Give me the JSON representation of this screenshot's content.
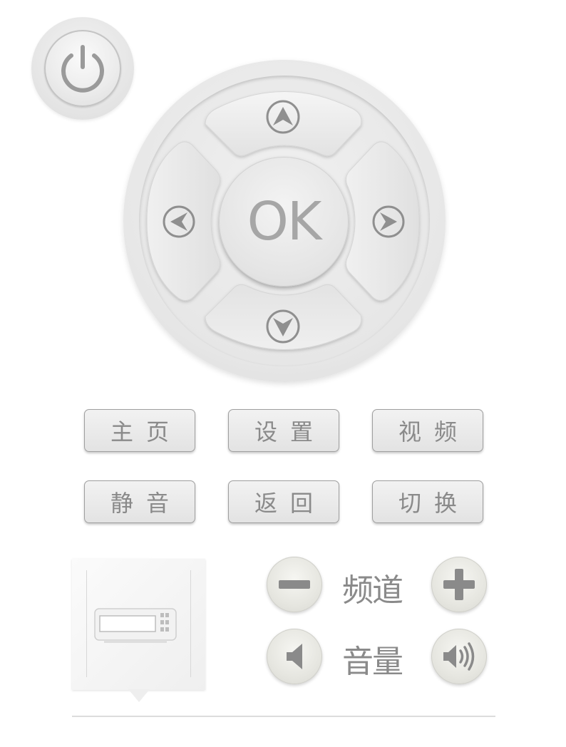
{
  "power": {
    "icon": "power-icon"
  },
  "dpad": {
    "ok_label": "OK",
    "icons": {
      "up": "arrow-up-icon",
      "down": "arrow-down-icon",
      "left": "arrow-left-icon",
      "right": "arrow-right-icon"
    }
  },
  "menu": {
    "row1": [
      {
        "label": "主页"
      },
      {
        "label": "设置"
      },
      {
        "label": "视频"
      }
    ],
    "row2": [
      {
        "label": "静音"
      },
      {
        "label": "返回"
      },
      {
        "label": "切换"
      }
    ]
  },
  "panel": {
    "icon": "remote-device-icon"
  },
  "channel": {
    "label": "频道",
    "minus_icon": "minus-icon",
    "plus_icon": "plus-icon"
  },
  "volume": {
    "label": "音量",
    "down_icon": "volume-down-icon",
    "up_icon": "volume-up-icon"
  },
  "colors": {
    "text": "#8a8a8a",
    "button_face": "#e8e8e8",
    "border": "#9f9f9f"
  }
}
